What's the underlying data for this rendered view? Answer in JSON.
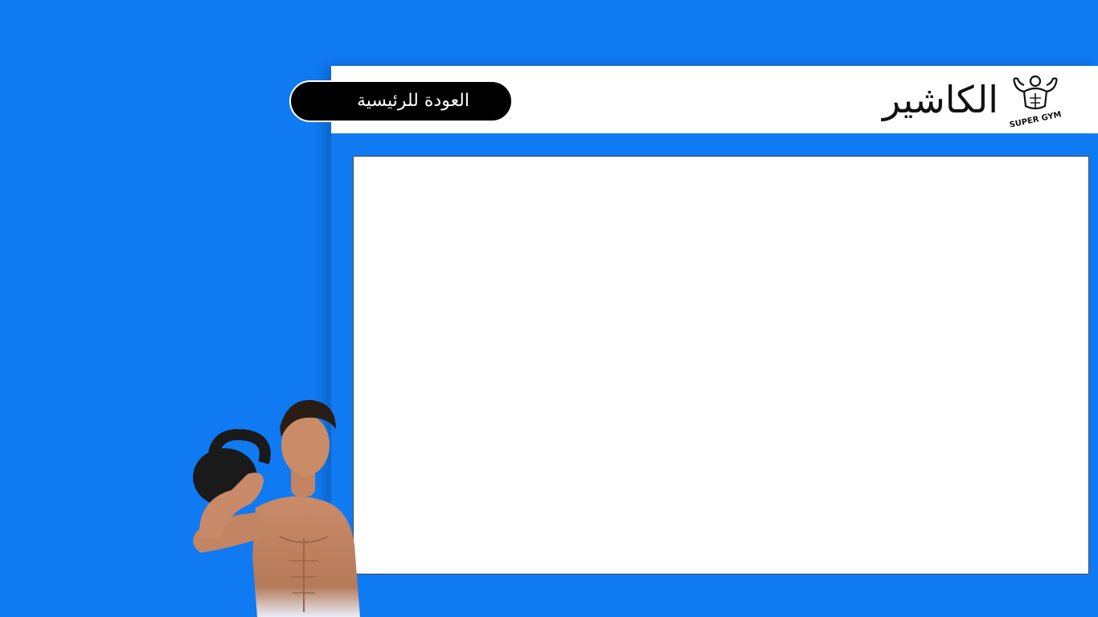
{
  "header": {
    "title": "الكاشير",
    "logo_text": "SUPER GYM"
  },
  "toolbar": {
    "back_label": "العودة للرئيسية"
  },
  "icons": {
    "logo": "gym-logo-icon",
    "hero": "man-with-kettlebell-image"
  },
  "colors": {
    "background": "#0f7af2",
    "header": "#ffffff",
    "button": "#000000",
    "button_text": "#ffffff",
    "content": "#ffffff"
  }
}
